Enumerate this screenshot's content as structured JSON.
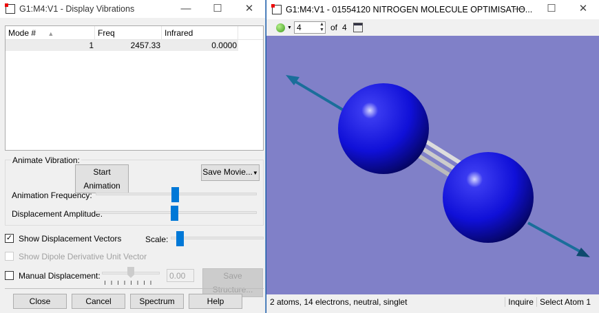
{
  "left_window": {
    "title": "G1:M4:V1 - Display Vibrations",
    "table": {
      "columns": [
        "Mode #",
        "Freq",
        "Infrared"
      ],
      "rows": [
        {
          "mode": "1",
          "freq": "2457.33",
          "infrared": "0.0000"
        }
      ]
    },
    "animate_group": "Animate Vibration:",
    "start_animation": "Start Animation",
    "save_movie": "Save Movie...",
    "animation_frequency": {
      "label": "Animation Frequency:",
      "value": 0.49
    },
    "displacement_amplitude": {
      "label": "Displacement Amplitude:",
      "value": 0.49
    },
    "show_vectors": {
      "label": "Show Displacement Vectors",
      "checked": true
    },
    "scale": {
      "label": "Scale:",
      "value": 0.1
    },
    "show_dipole": {
      "label": "Show Dipole Derivative Unit Vector",
      "checked": false,
      "disabled": true
    },
    "manual_displacement": {
      "label": "Manual Displacement:",
      "checked": false,
      "value": "0.00",
      "slider": 0.5
    },
    "save_structure": "Save Structure...",
    "buttons": {
      "close": "Close",
      "cancel": "Cancel",
      "spectrum": "Spectrum",
      "help": "Help"
    }
  },
  "right_window": {
    "title": "G1:M4:V1 - 01554120 NITROGEN MOLECULE OPTIMISATIO...",
    "frame": "4",
    "of": "of",
    "total": "4",
    "status": "2 atoms, 14 electrons, neutral, singlet",
    "mode": "Inquire",
    "action": "Select Atom 1",
    "colors": {
      "background": "#8080c8",
      "atom": "#1010e0",
      "vector": "#1a6e9a"
    }
  }
}
